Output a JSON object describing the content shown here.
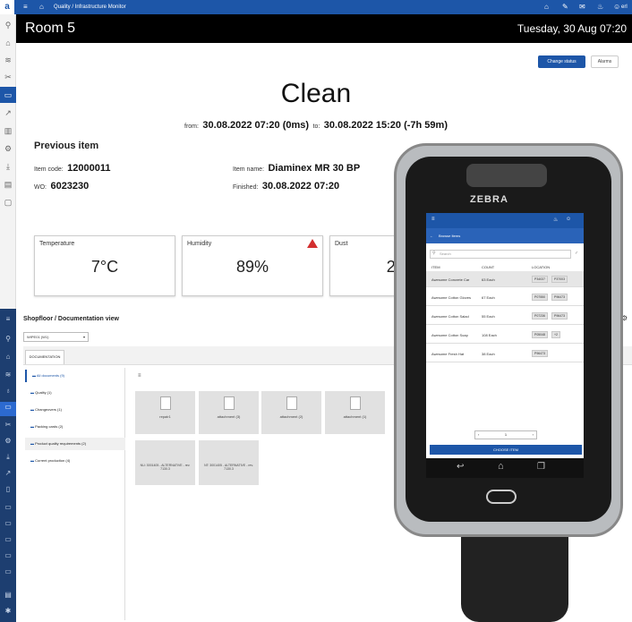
{
  "header": {
    "app_icon": "a",
    "breadcrumb": "Quality / Infrastructure Monitor",
    "user": "erl",
    "icons": [
      "home-icon",
      "pen-icon",
      "mail-icon",
      "bell-icon",
      "user-icon"
    ]
  },
  "room": {
    "title": "Room 5",
    "datetime": "Tuesday, 30 Aug 07:20"
  },
  "actions": {
    "change_status": "Change status",
    "alarms": "Alarms"
  },
  "status": {
    "label": "Clean",
    "from_label": "from:",
    "from_value": "30.08.2022 07:20 (0ms)",
    "to_label": "to:",
    "to_value": "30.08.2022 15:20 (-7h 59m)"
  },
  "previous": {
    "title": "Previous item",
    "item_code_label": "Item code:",
    "item_code": "12000011",
    "wo_label": "WO:",
    "wo": "6023230",
    "item_name_label": "Item name:",
    "item_name": "Diaminex MR 30 BP",
    "finished_label": "Finished:",
    "finished": "30.08.2022 07:20"
  },
  "sensors": [
    {
      "label": "Temperature",
      "value": "7°C"
    },
    {
      "label": "Humidity",
      "value": "89%",
      "alert": true
    },
    {
      "label": "Dust",
      "value": "2µg"
    }
  ],
  "doc": {
    "title": "Shopfloor / Documentation view",
    "select": "WIPE01 (W1)",
    "tab": "DOCUMENTATION",
    "folders": [
      {
        "label": "All documents (9)"
      },
      {
        "label": "Quality (1)"
      },
      {
        "label": "Changeovers (1)"
      },
      {
        "label": "Packing cards (2)"
      },
      {
        "label": "Product quality requirements (2)"
      },
      {
        "label": "Current production (4)"
      }
    ],
    "files": [
      "repair1",
      "attachment (3)",
      "attachment (2)",
      "attachment (1)",
      "NU: 3001405 - ALTERNATIVE - rev. 7130.3",
      "NT: 3001405 - ALTERNATIVE - rev. 7130.3"
    ]
  },
  "device": {
    "brand": "ZEBRA",
    "screen_title": "Browse Items",
    "search_placeholder": "Search",
    "cols": [
      "ITEM",
      "COUNT",
      "LOCATION"
    ],
    "rows": [
      {
        "item": "Awesome Concrete Car",
        "count": "63 Each",
        "locs": [
          "P34037",
          "P37003"
        ]
      },
      {
        "item": "Awesome Cotton Gloves",
        "count": "67 Each",
        "locs": [
          "P07550",
          "P96473"
        ]
      },
      {
        "item": "Awesome Cotton Salad",
        "count": "55 Each",
        "locs": [
          "P07236",
          "P96473"
        ]
      },
      {
        "item": "Awesome Cotton Soap",
        "count": "108 Each",
        "locs": [
          "P05048",
          "+2"
        ]
      },
      {
        "item": "Awesome Fresh Hat",
        "count": "38 Each",
        "locs": [
          "P96473"
        ]
      }
    ],
    "qty": "1",
    "choose": "CHOOSE ITEM"
  }
}
